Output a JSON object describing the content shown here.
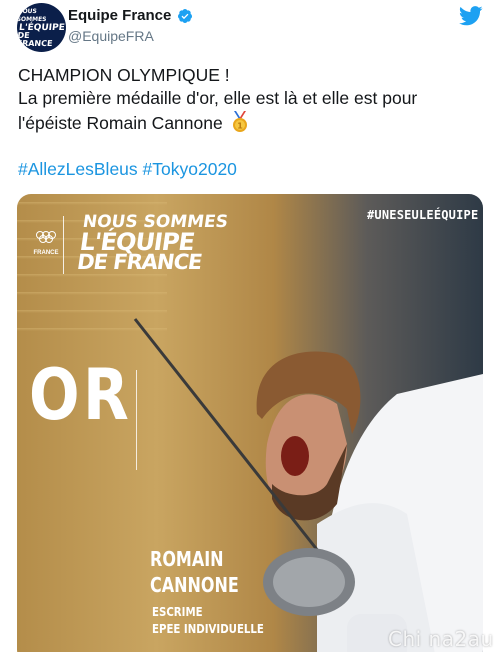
{
  "author": {
    "avatar_text": [
      "NOUS SOMMES",
      "L'ÉQUIPE",
      "DE FRANCE"
    ],
    "display_name": "Equipe France",
    "handle": "@EquipeFRA",
    "verified": true
  },
  "tweet": {
    "lines": [
      "CHAMPION OLYMPIQUE !",
      "La première médaille d'or, elle est là et elle est pour",
      "l'épéiste Romain Cannone"
    ],
    "emoji": "gold-medal-icon",
    "hashtags": [
      "#AllezLesBleus",
      "#Tokyo2020"
    ]
  },
  "media": {
    "slogan": [
      "NOUS SOMMES",
      "L'ÉQUIPE",
      "DE FRANCE"
    ],
    "france_logo_text": "FRANCE",
    "top_tag": "#UNESEULEÉQUIPE",
    "medal": "OR",
    "athlete": [
      "ROMAIN",
      "CANNONE"
    ],
    "event": [
      "ESCRIME",
      "EPEE INDIVIDUELLE"
    ]
  },
  "watermark": "Chi na2au",
  "colors": {
    "link": "#1b95e0",
    "twitter_blue": "#1da1f2",
    "text": "#14171a",
    "secondary_text": "#657786",
    "gold": "#c9a561"
  }
}
